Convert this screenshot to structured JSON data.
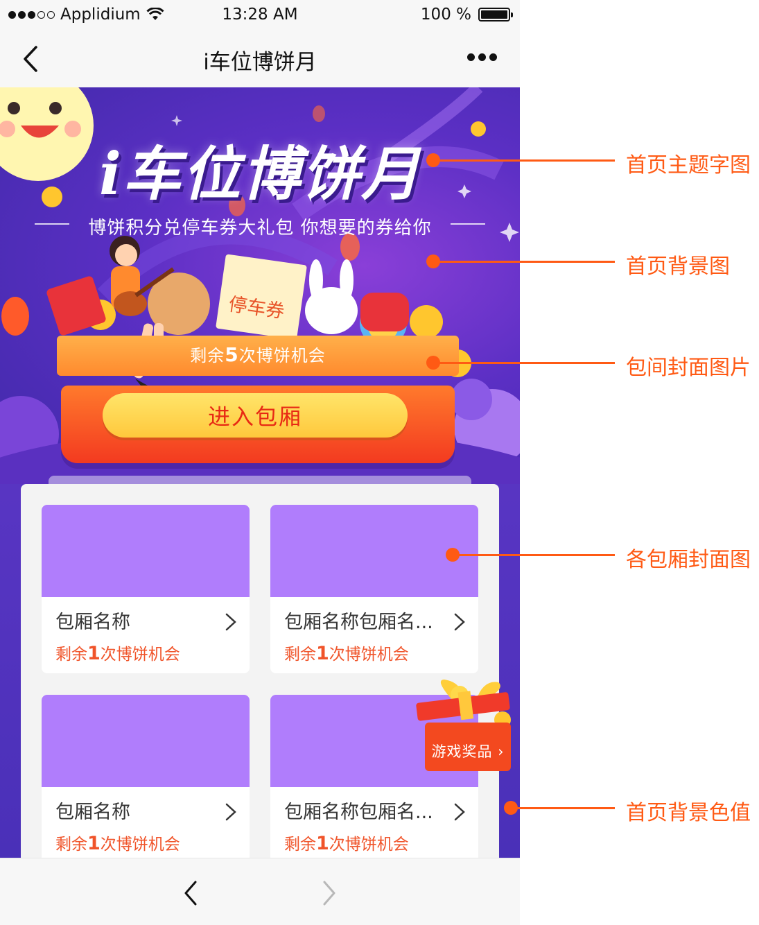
{
  "status_bar": {
    "carrier": "Applidium",
    "time": "13:28 AM",
    "battery": "100 %"
  },
  "nav": {
    "title": "i车位博饼月"
  },
  "hero": {
    "title": "i车位博饼月",
    "subtitle": "博饼积分兑停车券大礼包 你想要的券给你",
    "ticket_label": "停车券",
    "remaining_prefix": "剩余",
    "remaining_count": "5",
    "remaining_suffix": "次博饼机会",
    "enter_button": "进入包厢"
  },
  "rooms": [
    {
      "name": "包厢名称",
      "chances_prefix": "剩余",
      "chances_count": "1",
      "chances_suffix": "次博饼机会"
    },
    {
      "name": "包厢名称包厢名...",
      "chances_prefix": "剩余",
      "chances_count": "1",
      "chances_suffix": "次博饼机会"
    },
    {
      "name": "包厢名称",
      "chances_prefix": "剩余",
      "chances_count": "1",
      "chances_suffix": "次博饼机会"
    },
    {
      "name": "包厢名称包厢名...",
      "chances_prefix": "剩余",
      "chances_count": "1",
      "chances_suffix": "次博饼机会"
    }
  ],
  "prize_badge": {
    "label": "游戏奖品"
  },
  "annotations": [
    {
      "label": "首页主题字图"
    },
    {
      "label": "首页背景图"
    },
    {
      "label": "包间封面图片"
    },
    {
      "label": "各包厢封面图"
    },
    {
      "label": "首页背景色值"
    }
  ],
  "colors": {
    "annotation": "#ff5a14",
    "card_cover": "#b07dfc",
    "page_background": "#4a2bb0",
    "chances_text": "#f0542a"
  }
}
